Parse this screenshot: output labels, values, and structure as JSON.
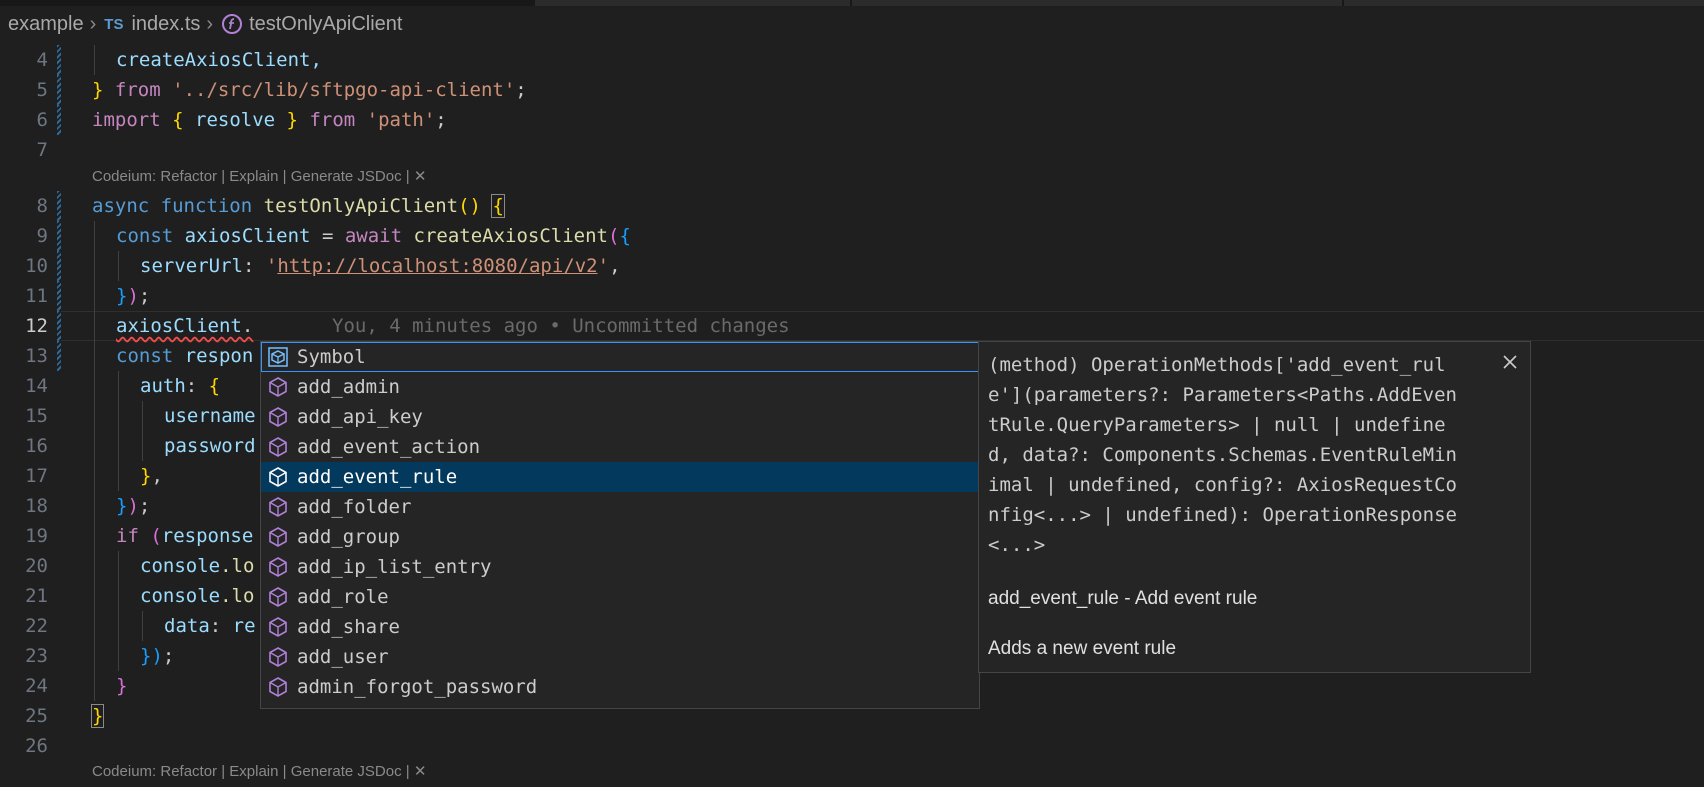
{
  "breadcrumb": {
    "folder": "example",
    "file_badge": "TS",
    "file": "index.ts",
    "symbol": "testOnlyApiClient",
    "symbol_icon": "function-symbol-icon"
  },
  "codelens": {
    "text": "Codeium: Refactor | Explain | Generate JSDoc | ✕",
    "text_bottom": "Codeium: Refactor | Explain | Generate JSDoc | ✕"
  },
  "lines": [
    {
      "n": "4"
    },
    {
      "n": "5"
    },
    {
      "n": "6"
    },
    {
      "n": "7"
    },
    {
      "n": "8"
    },
    {
      "n": "9"
    },
    {
      "n": "10"
    },
    {
      "n": "11"
    },
    {
      "n": "12"
    },
    {
      "n": "13"
    },
    {
      "n": "14"
    },
    {
      "n": "15"
    },
    {
      "n": "16"
    },
    {
      "n": "17"
    },
    {
      "n": "18"
    },
    {
      "n": "19"
    },
    {
      "n": "20"
    },
    {
      "n": "21"
    },
    {
      "n": "22"
    },
    {
      "n": "23"
    },
    {
      "n": "24"
    },
    {
      "n": "25"
    },
    {
      "n": "26"
    }
  ],
  "code": {
    "l4": "createAxiosClient,",
    "l5_brace": "}",
    "l5_from": "from",
    "l5_str": "'../src/lib/sftpgo-api-client'",
    "l5_end": ";",
    "l6_import": "import",
    "l6_ob": "{",
    "l6_name": "resolve",
    "l6_cb": "}",
    "l6_from": "from",
    "l6_str": "'path'",
    "l6_end": ";",
    "l8_async": "async",
    "l8_function": "function",
    "l8_name": "testOnlyApiClient",
    "l8_parens": "()",
    "l8_ob": "{",
    "l9_const": "const",
    "l9_var": "axiosClient",
    "l9_eq": "=",
    "l9_await": "await",
    "l9_fn": "createAxiosClient",
    "l9_p": "(",
    "l9_ob": "{",
    "l10_key": "serverUrl",
    "l10_colon": ":",
    "l10_q1": "'",
    "l10_url": "http://localhost:8080/api/v2",
    "l10_q2": "'",
    "l10_comma": ",",
    "l11_cb": "}",
    "l11_p": ")",
    "l11_end": ";",
    "l12_var": "axiosClient",
    "l12_dot": ".",
    "l12_blame": "You, 4 minutes ago • Uncommitted changes",
    "l13_const": "const",
    "l13_var": "respon",
    "l14_key": "auth",
    "l14_colon": ":",
    "l14_ob": "{",
    "l15_key": "username",
    "l16_key": "password",
    "l17_cb": "}",
    "l17_comma": ",",
    "l18_cb": "}",
    "l18_p": ")",
    "l18_end": ";",
    "l19_if": "if",
    "l19_p": "(",
    "l19_var": "response",
    "l20_obj": "console",
    "l20_rest": ".lo",
    "l21_obj": "console",
    "l21_rest": ".lo",
    "l22_key": "data",
    "l22_colon": ":",
    "l22_rest": "re",
    "l23_cb": "}",
    "l23_p": ")",
    "l23_end": ";",
    "l24_cb": "}",
    "l25_cb": "}"
  },
  "suggestions": [
    {
      "label": "Symbol",
      "icon": "class-symbol-icon"
    },
    {
      "label": "add_admin",
      "icon": "method-cube-icon"
    },
    {
      "label": "add_api_key",
      "icon": "method-cube-icon"
    },
    {
      "label": "add_event_action",
      "icon": "method-cube-icon"
    },
    {
      "label": "add_event_rule",
      "icon": "method-cube-icon",
      "selected": true
    },
    {
      "label": "add_folder",
      "icon": "method-cube-icon"
    },
    {
      "label": "add_group",
      "icon": "method-cube-icon"
    },
    {
      "label": "add_ip_list_entry",
      "icon": "method-cube-icon"
    },
    {
      "label": "add_role",
      "icon": "method-cube-icon"
    },
    {
      "label": "add_share",
      "icon": "method-cube-icon"
    },
    {
      "label": "add_user",
      "icon": "method-cube-icon"
    },
    {
      "label": "admin_forgot_password",
      "icon": "method-cube-icon"
    }
  ],
  "details": {
    "signature": "(method) OperationMethods['add_event_rul\ne'](parameters?: Parameters<Paths.AddEven\ntRule.QueryParameters> | null | undefine\nd, data?: Components.Schemas.EventRuleMin\nimal | undefined, config?: AxiosRequestCo\nnfig<...> | undefined): OperationResponse\n<...>",
    "doc_title": "add_event_rule - Add event rule",
    "doc_body": "Adds a new event rule",
    "close_icon": "close-icon"
  },
  "colors": {
    "background": "#1f1f1f",
    "selection": "#04395e",
    "keyword": "#c586c0",
    "function": "#dcdcaa",
    "variable": "#9cdcfe",
    "string": "#ce9178",
    "bracket_gold": "#ffd700",
    "bracket_orchid": "#da70d6",
    "bracket_blue": "#179fff",
    "error": "#f14c4c"
  }
}
